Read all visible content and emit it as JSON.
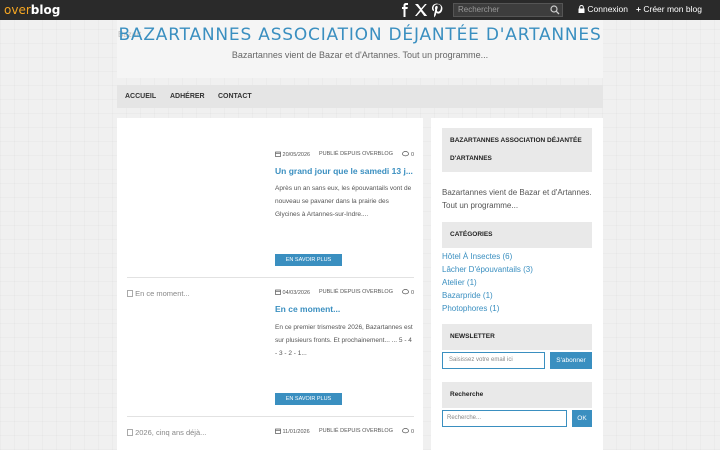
{
  "topbar": {
    "logo_part1": "over",
    "logo_part2": "blog",
    "search_placeholder": "Rechercher",
    "login_label": "Connexion",
    "create_label": "Créer mon blog"
  },
  "header": {
    "title": "BAZARTANNES ASSOCIATION DÉJANTÉE D'ARTANNES",
    "subtitle": "Bazartannes vient de Bazar et d'Artannes. Tout un programme...",
    "broken_image_alt": "Bazart"
  },
  "nav": {
    "items": [
      "ACCUEIL",
      "ADHÉRER",
      "CONTACT"
    ]
  },
  "posts": [
    {
      "image_alt": "",
      "date": "20/05/2026",
      "source": "PUBLIÉ DEPUIS OVERBLOG",
      "comments": "0",
      "title": "Un grand jour que le samedi 13 j...",
      "excerpt": "Après un an sans eux, les épouvantails vont de nouveau se pavaner dans la prairie des Glycines à Artannes-sur-Indre....",
      "more": "EN SAVOIR PLUS"
    },
    {
      "image_alt": "En ce moment...",
      "date": "04/03/2026",
      "source": "PUBLIÉ DEPUIS OVERBLOG",
      "comments": "0",
      "title": "En ce moment...",
      "excerpt": "En ce premier trismestre 2026, Bazartannes est sur plusieurs fronts. Et prochainement... ... 5 - 4 - 3 - 2 - 1...",
      "more": "EN SAVOIR PLUS"
    },
    {
      "image_alt": "2026, cinq ans déjà...",
      "date": "11/01/2026",
      "source": "PUBLIÉ DEPUIS OVERBLOG",
      "comments": "0"
    }
  ],
  "sidebar": {
    "about_title": "BAZARTANNES ASSOCIATION DÉJANTÉE D'ARTANNES",
    "about_text": "Bazartannes vient de Bazar et d'Artannes. Tout un programme...",
    "categories_title": "CATÉGORIES",
    "categories": [
      "Hôtel À Insectes (6)",
      "Lâcher D'épouvantails (3)",
      "Atelier (1)",
      "Bazarpride (1)",
      "Photophores (1)"
    ],
    "newsletter_title": "NEWSLETTER",
    "email_placeholder": "Saisissez votre email ici",
    "subscribe_label": "S'abonner",
    "search_title": "Recherche",
    "search_placeholder": "Recherche...",
    "ok_label": "OK"
  },
  "colors": {
    "accent": "#3a8fc0",
    "topbar": "#2a2a2a"
  },
  "icons": [
    "facebook-icon",
    "x-icon",
    "pinterest-icon",
    "search-icon",
    "lock-icon",
    "plus-icon",
    "calendar-icon",
    "comment-icon"
  ]
}
